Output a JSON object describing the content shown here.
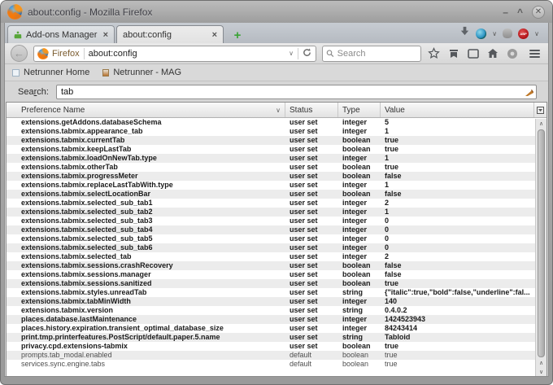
{
  "colors": {
    "new-tab-green": "#3aa335",
    "adblock-red": "#b01116",
    "titlebar-gray": "#a8a8a8",
    "userset-text": "#1a1a1a"
  },
  "window": {
    "title": "about:config - Mozilla Firefox",
    "controls": {
      "minimize": "–",
      "maximize": "^",
      "close": "✕"
    }
  },
  "tab_strip": {
    "tabs": [
      {
        "title": "Add-ons Manager",
        "close": "×"
      },
      {
        "title": "about:config",
        "close": "×"
      }
    ],
    "new_tab_label": "+",
    "addon_buttons": [
      "download-indicator",
      "proxy-globe",
      "disabled-addon",
      "adblock-plus"
    ],
    "adblock_label": "ABP",
    "dropdown_chevron": "∨"
  },
  "navbar": {
    "back_arrow": "←",
    "url_chip": "Firefox",
    "url": "about:config",
    "url_chevron": "∨",
    "search_placeholder": "Search",
    "toolbar_icons": [
      "bookmark-star",
      "bookmarks-panel",
      "tab-groups",
      "home",
      "hello-chat",
      "menu"
    ]
  },
  "bookmarks_bar": {
    "items": [
      {
        "label": "Netrunner Home"
      },
      {
        "label": "Netrunner - MAG"
      }
    ]
  },
  "config_page": {
    "search_label_pre": "Sea",
    "search_label_key": "r",
    "search_label_post": "ch:",
    "search_value": "tab"
  },
  "table": {
    "headers": {
      "name": "Preference Name",
      "status": "Status",
      "type": "Type",
      "value": "Value",
      "sort_indicator": "∨"
    },
    "rows": [
      {
        "name": "extensions.getAddons.databaseSchema",
        "status": "user set",
        "type": "integer",
        "value": "5"
      },
      {
        "name": "extensions.tabmix.appearance_tab",
        "status": "user set",
        "type": "integer",
        "value": "1"
      },
      {
        "name": "extensions.tabmix.currentTab",
        "status": "user set",
        "type": "boolean",
        "value": "true"
      },
      {
        "name": "extensions.tabmix.keepLastTab",
        "status": "user set",
        "type": "boolean",
        "value": "true"
      },
      {
        "name": "extensions.tabmix.loadOnNewTab.type",
        "status": "user set",
        "type": "integer",
        "value": "1"
      },
      {
        "name": "extensions.tabmix.otherTab",
        "status": "user set",
        "type": "boolean",
        "value": "true"
      },
      {
        "name": "extensions.tabmix.progressMeter",
        "status": "user set",
        "type": "boolean",
        "value": "false"
      },
      {
        "name": "extensions.tabmix.replaceLastTabWith.type",
        "status": "user set",
        "type": "integer",
        "value": "1"
      },
      {
        "name": "extensions.tabmix.selectLocationBar",
        "status": "user set",
        "type": "boolean",
        "value": "false"
      },
      {
        "name": "extensions.tabmix.selected_sub_tab1",
        "status": "user set",
        "type": "integer",
        "value": "2"
      },
      {
        "name": "extensions.tabmix.selected_sub_tab2",
        "status": "user set",
        "type": "integer",
        "value": "1"
      },
      {
        "name": "extensions.tabmix.selected_sub_tab3",
        "status": "user set",
        "type": "integer",
        "value": "0"
      },
      {
        "name": "extensions.tabmix.selected_sub_tab4",
        "status": "user set",
        "type": "integer",
        "value": "0"
      },
      {
        "name": "extensions.tabmix.selected_sub_tab5",
        "status": "user set",
        "type": "integer",
        "value": "0"
      },
      {
        "name": "extensions.tabmix.selected_sub_tab6",
        "status": "user set",
        "type": "integer",
        "value": "0"
      },
      {
        "name": "extensions.tabmix.selected_tab",
        "status": "user set",
        "type": "integer",
        "value": "2"
      },
      {
        "name": "extensions.tabmix.sessions.crashRecovery",
        "status": "user set",
        "type": "boolean",
        "value": "false"
      },
      {
        "name": "extensions.tabmix.sessions.manager",
        "status": "user set",
        "type": "boolean",
        "value": "false"
      },
      {
        "name": "extensions.tabmix.sessions.sanitized",
        "status": "user set",
        "type": "boolean",
        "value": "true"
      },
      {
        "name": "extensions.tabmix.styles.unreadTab",
        "status": "user set",
        "type": "string",
        "value": "{\"italic\":true,\"bold\":false,\"underline\":fal..."
      },
      {
        "name": "extensions.tabmix.tabMinWidth",
        "status": "user set",
        "type": "integer",
        "value": "140"
      },
      {
        "name": "extensions.tabmix.version",
        "status": "user set",
        "type": "string",
        "value": "0.4.0.2"
      },
      {
        "name": "places.database.lastMaintenance",
        "status": "user set",
        "type": "integer",
        "value": "1424523943"
      },
      {
        "name": "places.history.expiration.transient_optimal_database_size",
        "status": "user set",
        "type": "integer",
        "value": "84243414"
      },
      {
        "name": "print.tmp.printerfeatures.PostScript/default.paper.5.name",
        "status": "user set",
        "type": "string",
        "value": "Tabloid"
      },
      {
        "name": "privacy.cpd.extensions-tabmix",
        "status": "user set",
        "type": "boolean",
        "value": "true"
      },
      {
        "name": "prompts.tab_modal.enabled",
        "status": "default",
        "type": "boolean",
        "value": "true"
      },
      {
        "name": "services.sync.engine.tabs",
        "status": "default",
        "type": "boolean",
        "value": "true"
      }
    ]
  },
  "scrollbar": {
    "up_arrow": "∧",
    "down_arrow": "∨"
  }
}
